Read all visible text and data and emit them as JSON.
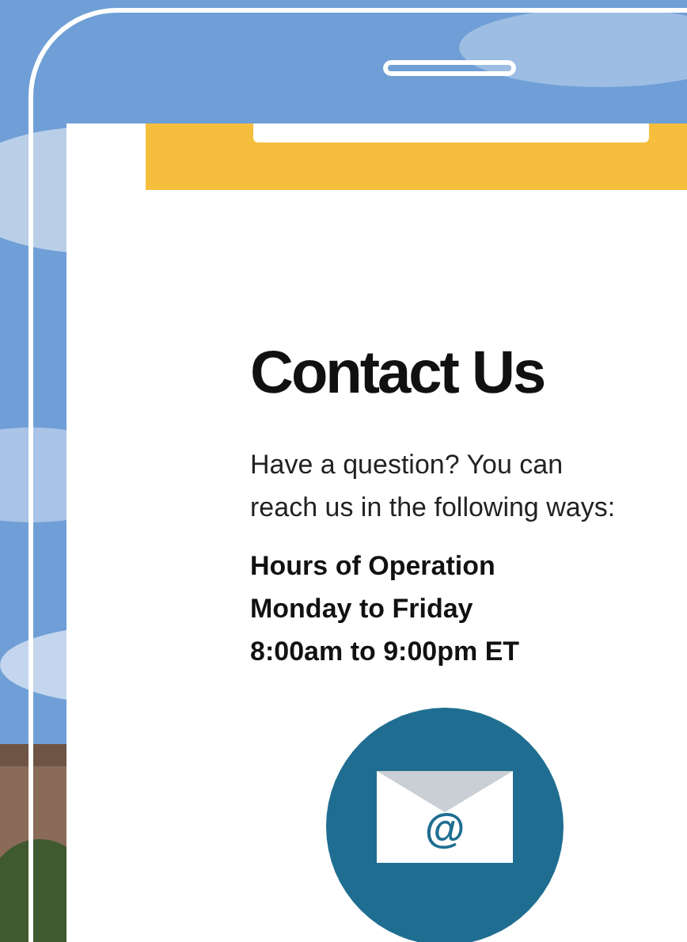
{
  "page": {
    "title": "Contact Us",
    "intro": "Have a question? You can reach us in the following ways:",
    "hours": [
      "Hours of Operation",
      "Monday to Friday",
      "8:00am to 9:00pm ET"
    ],
    "email_symbol": "@"
  }
}
